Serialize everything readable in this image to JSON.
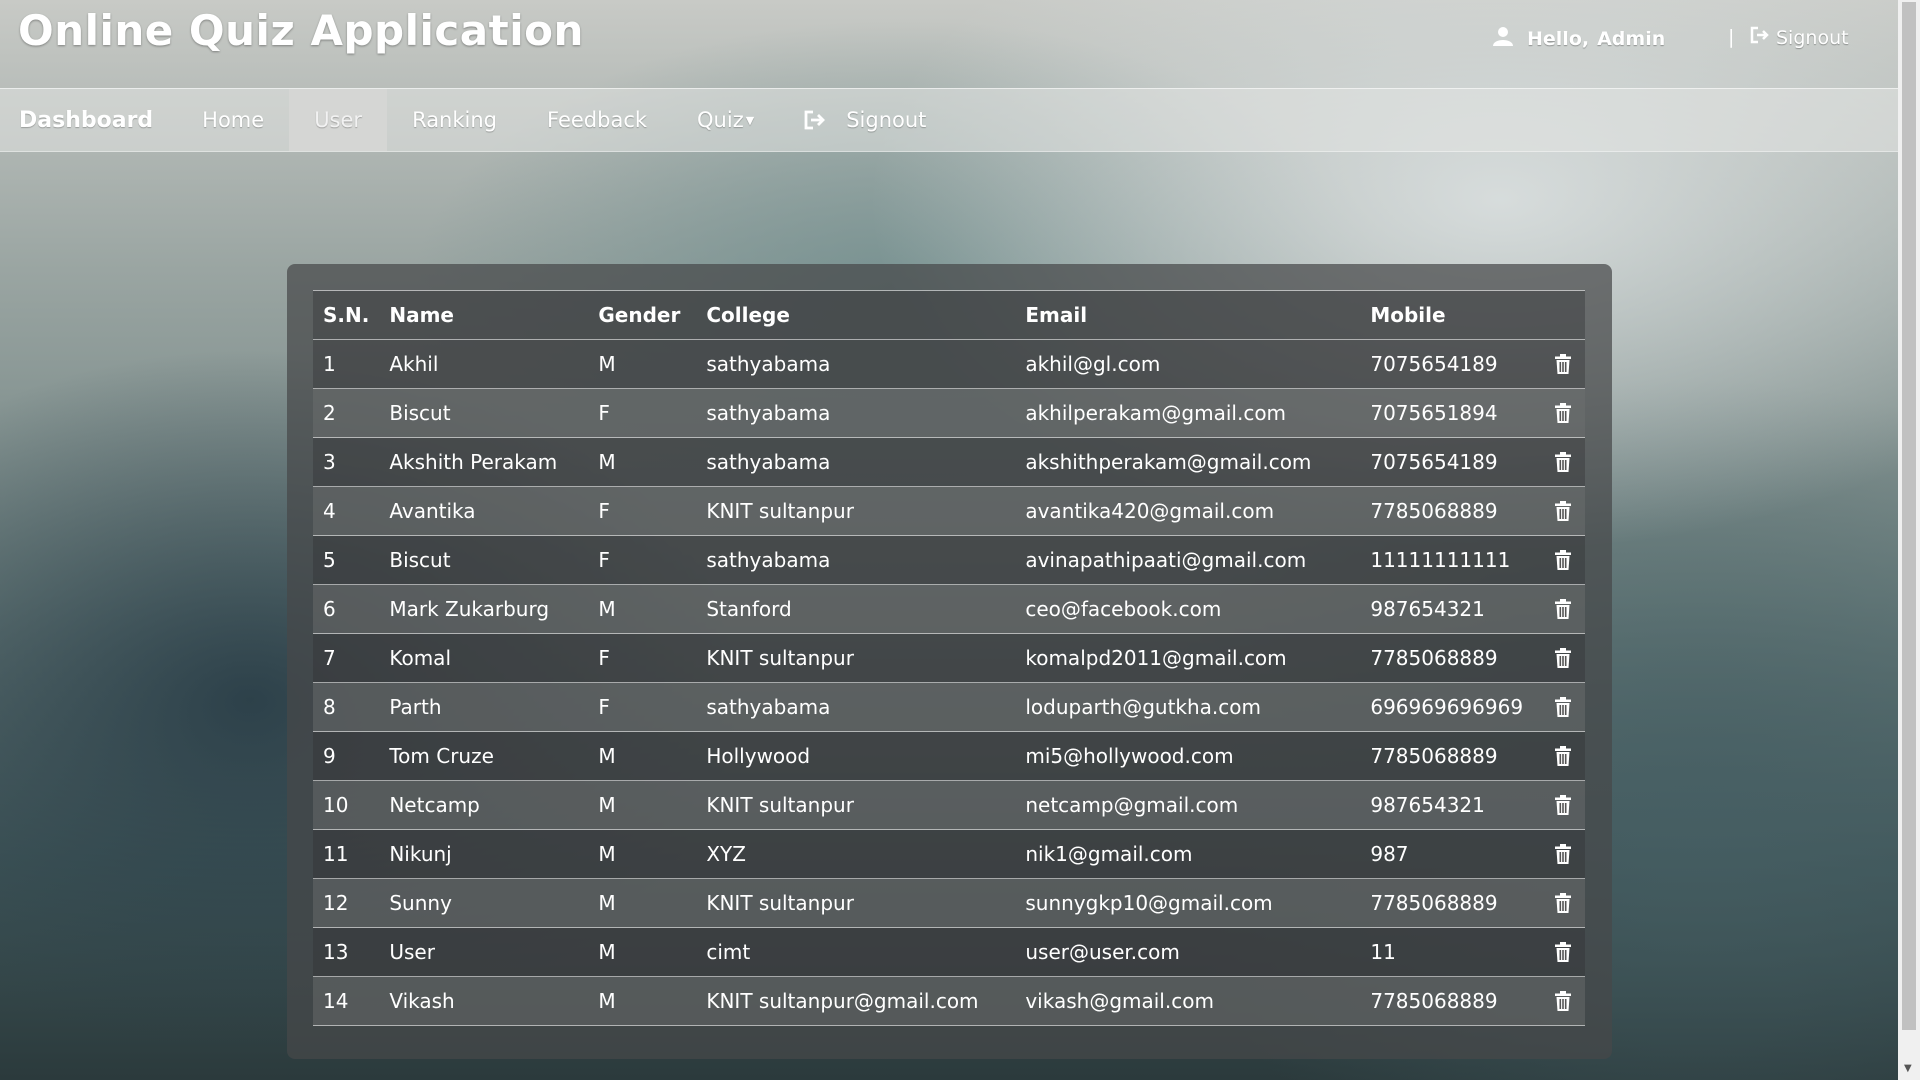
{
  "header": {
    "app_title": "Online Quiz Application",
    "greeting_hello": "Hello,",
    "greeting_user": "Admin",
    "separator": "|",
    "signout": "Signout"
  },
  "nav": {
    "brand": "Dashboard",
    "home": "Home",
    "user": "User",
    "ranking": "Ranking",
    "feedback": "Feedback",
    "quiz": "Quiz",
    "signout": "Signout",
    "active_item": "User"
  },
  "icons": {
    "user": "user-icon",
    "signout": "signout-icon",
    "delete": "trash-icon",
    "dropdown": "caret-down-icon"
  },
  "table": {
    "columns": [
      "S.N.",
      "Name",
      "Gender",
      "College",
      "Email",
      "Mobile"
    ],
    "rows": [
      {
        "sn": "1",
        "name": "Akhil",
        "gender": "M",
        "college": "sathyabama",
        "email": "akhil@gl.com",
        "mobile": "7075654189"
      },
      {
        "sn": "2",
        "name": "Biscut",
        "gender": "F",
        "college": "sathyabama",
        "email": "akhilperakam@gmail.com",
        "mobile": "7075651894"
      },
      {
        "sn": "3",
        "name": "Akshith Perakam",
        "gender": "M",
        "college": "sathyabama",
        "email": "akshithperakam@gmail.com",
        "mobile": "7075654189"
      },
      {
        "sn": "4",
        "name": "Avantika",
        "gender": "F",
        "college": "KNIT sultanpur",
        "email": "avantika420@gmail.com",
        "mobile": "7785068889"
      },
      {
        "sn": "5",
        "name": "Biscut",
        "gender": "F",
        "college": "sathyabama",
        "email": "avinapathipaati@gmail.com",
        "mobile": "11111111111"
      },
      {
        "sn": "6",
        "name": "Mark Zukarburg",
        "gender": "M",
        "college": "Stanford",
        "email": "ceo@facebook.com",
        "mobile": "987654321"
      },
      {
        "sn": "7",
        "name": "Komal",
        "gender": "F",
        "college": "KNIT sultanpur",
        "email": "komalpd2011@gmail.com",
        "mobile": "7785068889"
      },
      {
        "sn": "8",
        "name": "Parth",
        "gender": "F",
        "college": "sathyabama",
        "email": "loduparth@gutkha.com",
        "mobile": "696969696969"
      },
      {
        "sn": "9",
        "name": "Tom Cruze",
        "gender": "M",
        "college": "Hollywood",
        "email": "mi5@hollywood.com",
        "mobile": "7785068889"
      },
      {
        "sn": "10",
        "name": "Netcamp",
        "gender": "M",
        "college": "KNIT sultanpur",
        "email": "netcamp@gmail.com",
        "mobile": "987654321"
      },
      {
        "sn": "11",
        "name": "Nikunj",
        "gender": "M",
        "college": "XYZ",
        "email": "nik1@gmail.com",
        "mobile": "987"
      },
      {
        "sn": "12",
        "name": "Sunny",
        "gender": "M",
        "college": "KNIT sultanpur",
        "email": "sunnygkp10@gmail.com",
        "mobile": "7785068889"
      },
      {
        "sn": "13",
        "name": "User",
        "gender": "M",
        "college": "cimt",
        "email": "user@user.com",
        "mobile": "11"
      },
      {
        "sn": "14",
        "name": "Vikash",
        "gender": "M",
        "college": "KNIT sultanpur@gmail.com",
        "email": "vikash@gmail.com",
        "mobile": "7785068889"
      }
    ]
  }
}
